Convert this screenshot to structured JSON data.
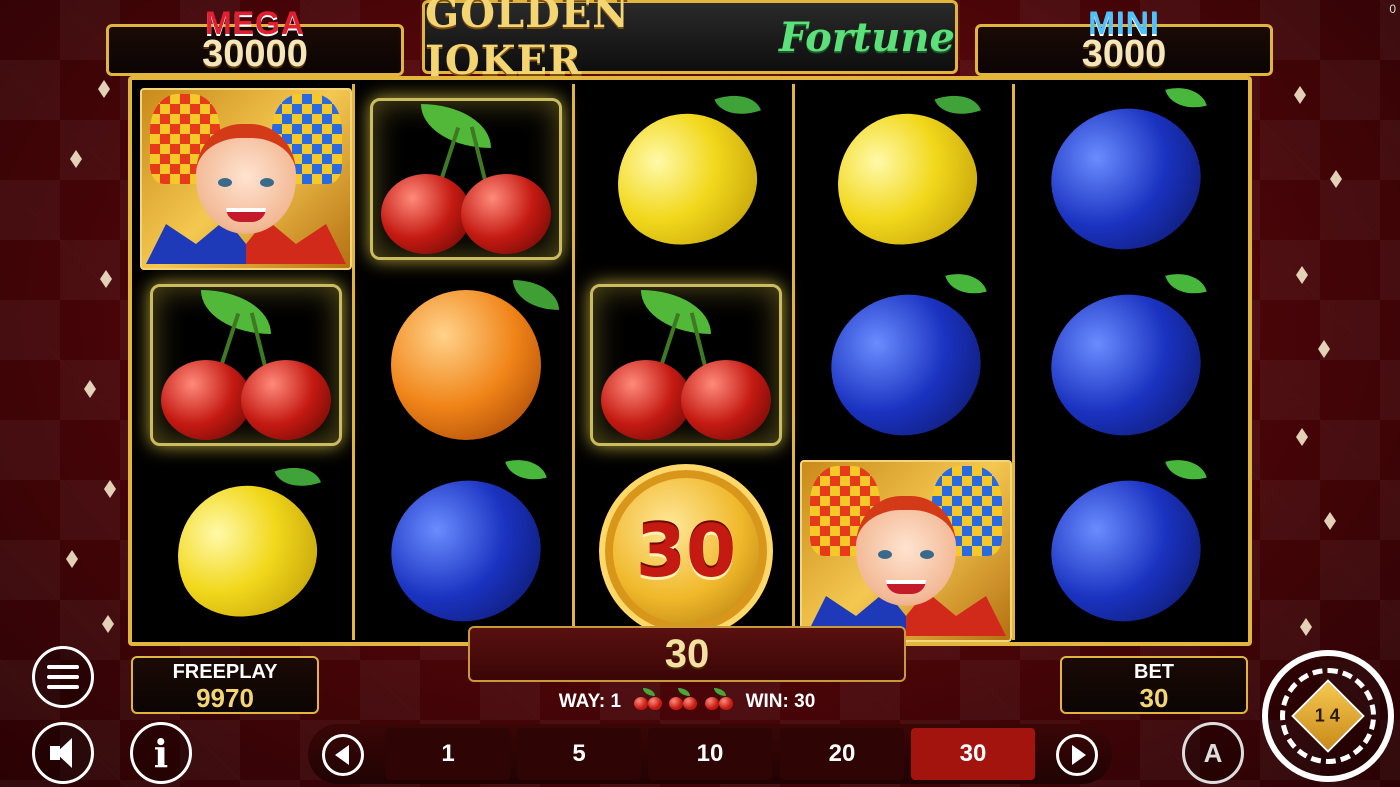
{
  "corner_counter": "0",
  "jackpots": {
    "mega": {
      "label": "MEGA",
      "value": "30000"
    },
    "mini": {
      "label": "MINI",
      "value": "3000"
    }
  },
  "logo": {
    "main": "GOLDEN JOKER",
    "script": "Fortune"
  },
  "reels": [
    [
      "joker",
      "cherries",
      "lemon"
    ],
    [
      "cherries",
      "orange",
      "plum"
    ],
    [
      "lemon",
      "cherries",
      "coin"
    ],
    [
      "lemon",
      "plum",
      "joker"
    ],
    [
      "plum",
      "plum",
      "plum"
    ]
  ],
  "highlighted_cells": [
    [
      0,
      1
    ],
    [
      1,
      0
    ],
    [
      2,
      1
    ]
  ],
  "coin_value": "30",
  "win_display": "30",
  "way_info": {
    "way_label": "WAY: 1",
    "win_label": "WIN: 30",
    "symbol": "cherries",
    "symbol_count": 3
  },
  "freeplay": {
    "label": "FREEPLAY",
    "value": "9970"
  },
  "bet": {
    "label": "BET",
    "value": "30"
  },
  "bet_options": [
    "1",
    "5",
    "10",
    "20",
    "30"
  ],
  "selected_bet": "30",
  "spin_button": {
    "icon": "cube-spin-icon",
    "label": "1 4"
  },
  "icons": {
    "menu": "hamburger-menu-icon",
    "sound": "speaker-icon",
    "info": "info-icon",
    "autoplay": "autoplay-icon",
    "prev": "chevron-left-icon",
    "next": "chevron-right-icon"
  },
  "colors": {
    "gold": "#e2b63c",
    "background": "#7a0d12",
    "mega": "#e02030",
    "mini": "#4cc2ff",
    "selected_bet": "#a3140e"
  }
}
